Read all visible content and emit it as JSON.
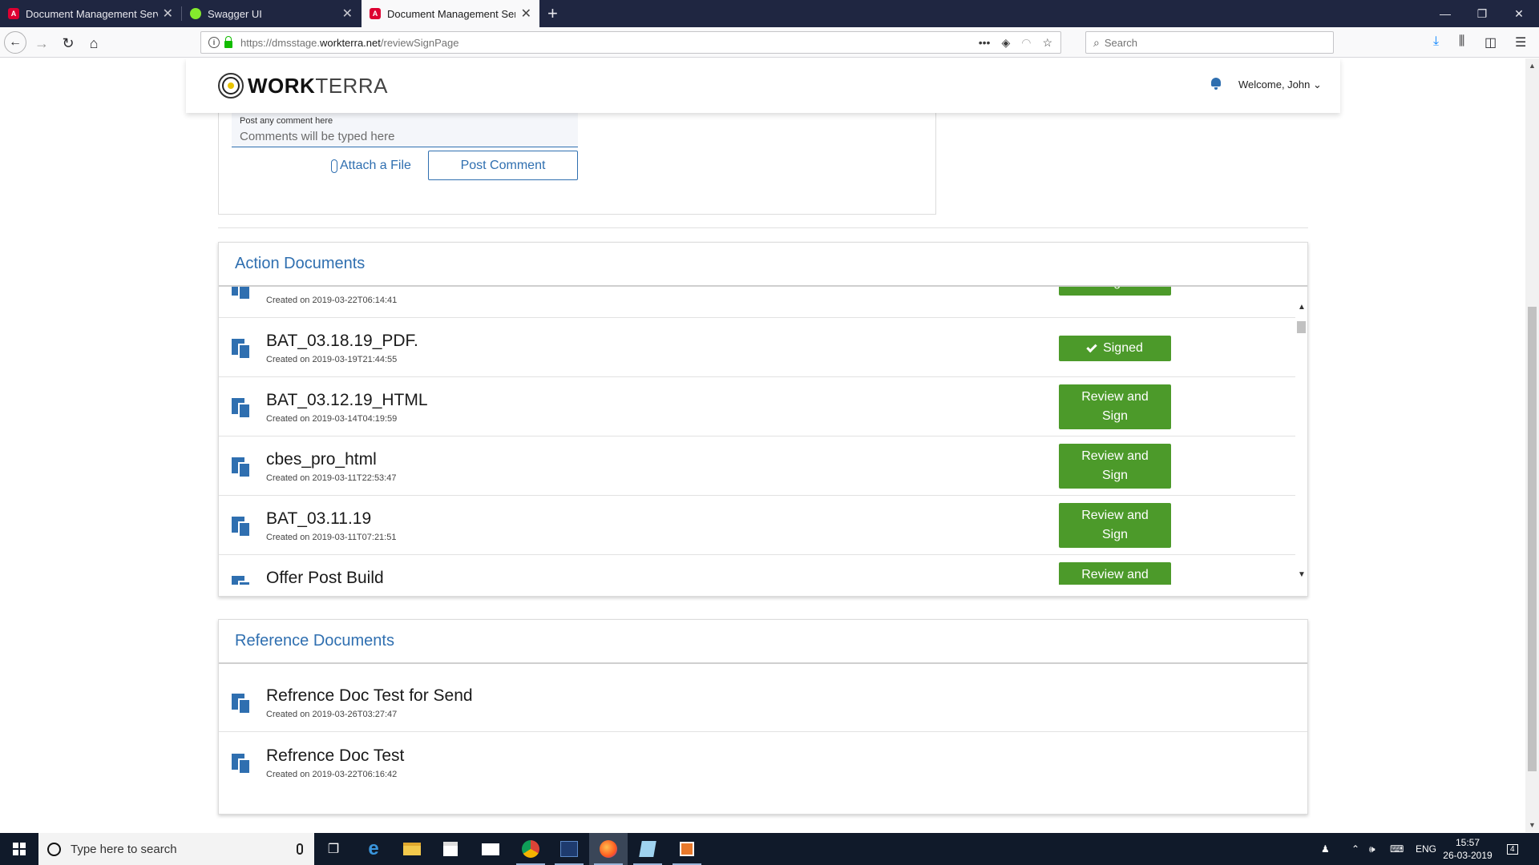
{
  "browser": {
    "tabs": [
      {
        "title": "Document Management Servic",
        "favicon": "angular-icon"
      },
      {
        "title": "Swagger UI",
        "favicon": "swagger-icon"
      },
      {
        "title": "Document Management Servic",
        "favicon": "angular-icon",
        "active": true
      }
    ],
    "url_prefix": "https://dmsstage.",
    "url_domain": "workterra.net",
    "url_path": "/reviewSignPage",
    "search_placeholder": "Search"
  },
  "app": {
    "logo_bold": "WORK",
    "logo_light": "TERRA",
    "welcome": "Welcome, John"
  },
  "comment": {
    "label": "Post any comment here",
    "placeholder": "Comments will be typed here",
    "attach_label": "Attach a File",
    "post_label": "Post Comment"
  },
  "action_documents": {
    "title": "Action Documents",
    "rows": [
      {
        "name": "",
        "created": "Created on 2019-03-22T06:14:41",
        "button": "Sign",
        "status": "sign"
      },
      {
        "name": "BAT_03.18.19_PDF.",
        "created": "Created on 2019-03-19T21:44:55",
        "button": "Signed",
        "status": "signed"
      },
      {
        "name": "BAT_03.12.19_HTML",
        "created": "Created on 2019-03-14T04:19:59",
        "button": "Review and Sign",
        "status": "review"
      },
      {
        "name": "cbes_pro_html",
        "created": "Created on 2019-03-11T22:53:47",
        "button": "Review and Sign",
        "status": "review"
      },
      {
        "name": "BAT_03.11.19",
        "created": "Created on 2019-03-11T07:21:51",
        "button": "Review and Sign",
        "status": "review"
      },
      {
        "name": "Offer Post Build",
        "created": "",
        "button": "Review and",
        "status": "review"
      }
    ]
  },
  "reference_documents": {
    "title": "Reference Documents",
    "rows": [
      {
        "name": "Refrence Doc Test for Send",
        "created": "Created on 2019-03-26T03:27:47"
      },
      {
        "name": "Refrence Doc Test",
        "created": "Created on 2019-03-22T06:16:42"
      }
    ]
  },
  "taskbar": {
    "search_placeholder": "Type here to search",
    "language": "ENG",
    "time": "15:57",
    "date": "26-03-2019",
    "notifications": "4"
  },
  "colors": {
    "accent": "#2f6fb0",
    "button_green": "#4c9a2a",
    "tab_bar": "#1f2641",
    "taskbar": "#101a2a"
  }
}
